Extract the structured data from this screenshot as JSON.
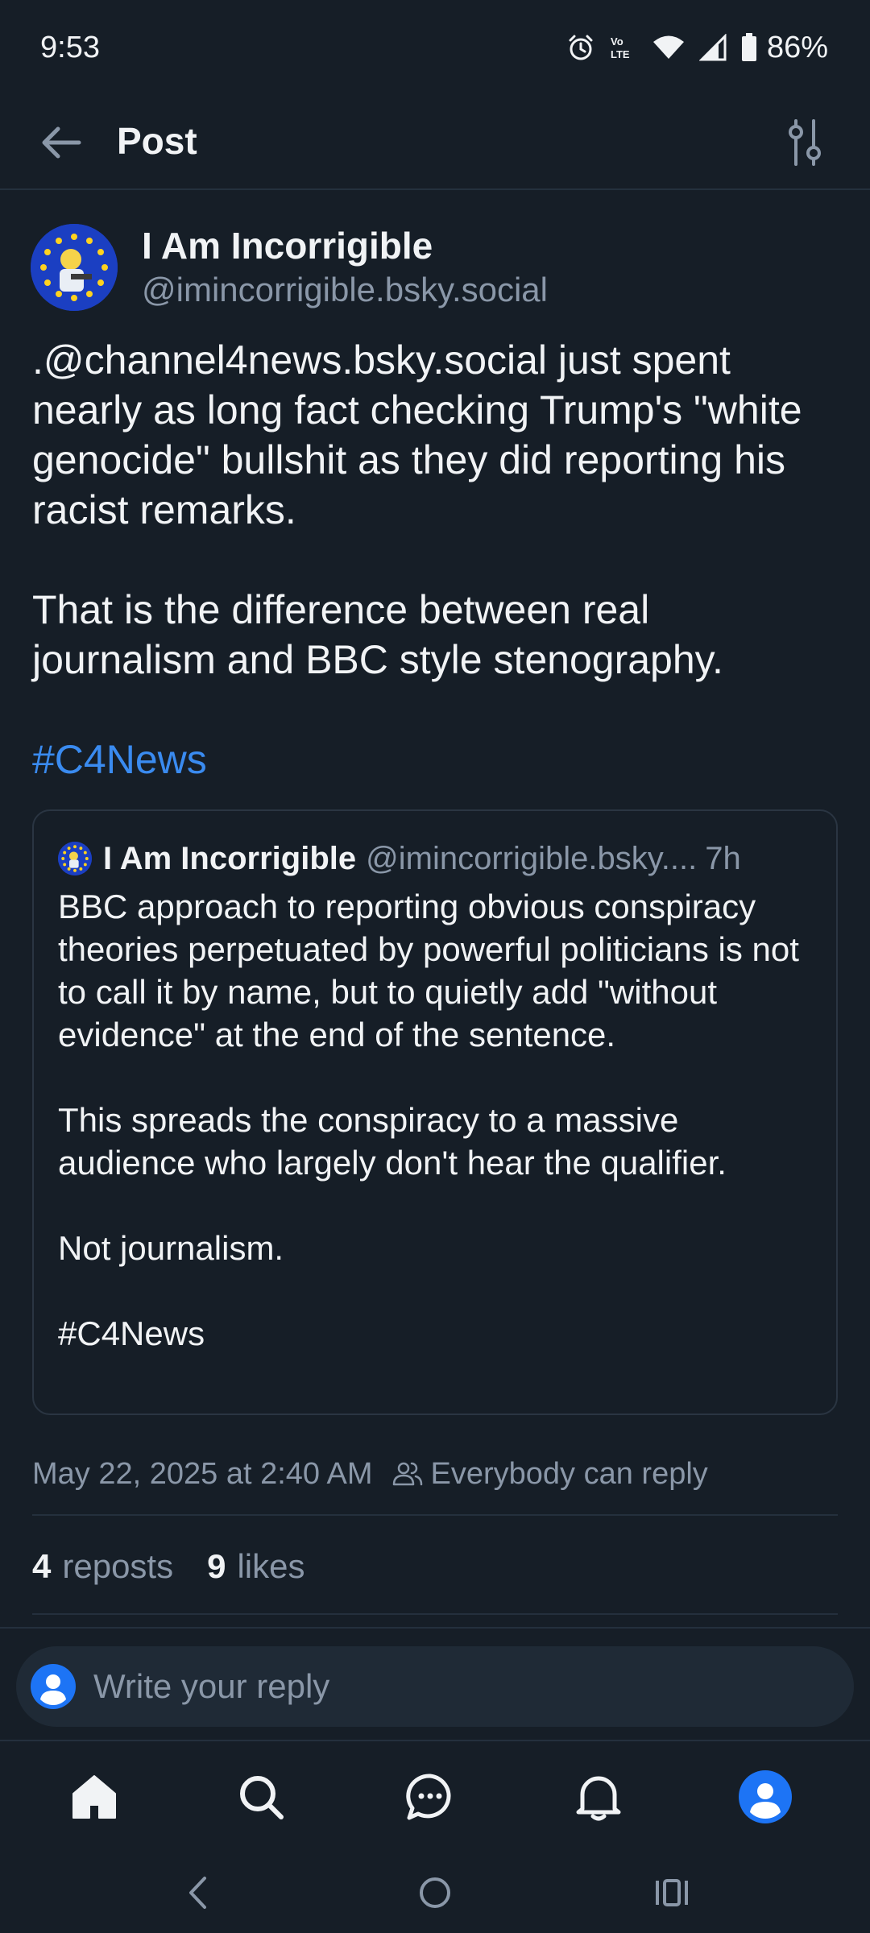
{
  "status_bar": {
    "time": "9:53",
    "battery": "86%",
    "icons": [
      "alarm-icon",
      "volte-icon",
      "wifi-icon",
      "signal-icon",
      "battery-icon"
    ]
  },
  "header": {
    "title": "Post",
    "back_icon": "arrow-left-icon",
    "filter_icon": "sliders-icon"
  },
  "post": {
    "author_name": "I Am Incorrigible",
    "author_handle": "@imincorrigible.bsky.social",
    "paragraphs": [
      ".@channel4news.bsky.social just spent nearly as long fact checking Trump's \"white genocide\" bullshit as they did reporting his racist remarks.",
      "That is the difference between real journalism and BBC style stenography."
    ],
    "hashtag": "#C4News",
    "timestamp": "May 22, 2025 at 2:40 AM",
    "reply_setting": "Everybody can reply",
    "reposts_count": "4",
    "reposts_label": "reposts",
    "likes_count": "9",
    "likes_label": "likes"
  },
  "quote": {
    "author_name": "I Am Incorrigible",
    "author_handle": "@imincorrigible.bsky....",
    "time": "7h",
    "paragraphs": [
      "BBC approach to reporting obvious conspiracy theories perpetuated by powerful politicians is not to call it by name, but to quietly add \"without evidence\" at the end of the sentence.",
      "This spreads the conspiracy to a massive audience who largely don't hear the qualifier.",
      "Not journalism.",
      "#C4News"
    ]
  },
  "reply": {
    "placeholder": "Write your reply"
  },
  "bottom_nav": [
    "home-icon",
    "search-icon",
    "chat-icon",
    "bell-icon",
    "profile-icon"
  ],
  "system_nav": [
    "back-icon",
    "home-circle-icon",
    "recents-icon"
  ],
  "colors": {
    "background": "#161e27",
    "accent": "#3a8bf0",
    "muted_text": "#8a97a8",
    "divider": "#24303d",
    "avatar_blue": "#1b3fc2"
  }
}
